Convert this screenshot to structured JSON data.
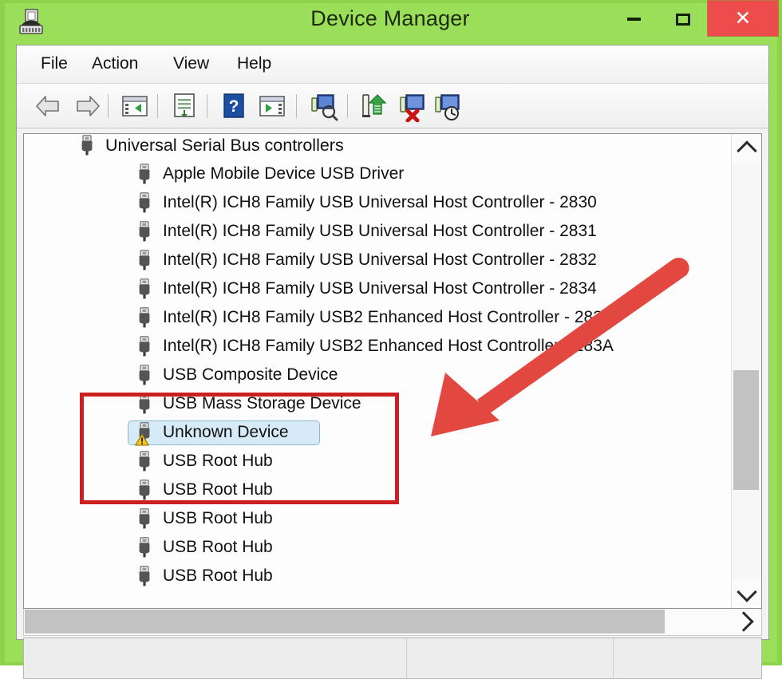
{
  "window": {
    "title": "Device Manager",
    "app_icon": "device-manager-icon",
    "frame_color": "#8ed14a",
    "controls": {
      "minimize_label": "–",
      "maximize_label": "□",
      "close_label": "✕",
      "close_bg": "#ec4c4c"
    }
  },
  "menu": {
    "items": [
      {
        "label": "File",
        "name": "menu-file"
      },
      {
        "label": "Action",
        "name": "menu-action"
      },
      {
        "label": "View",
        "name": "menu-view"
      },
      {
        "label": "Help",
        "name": "menu-help"
      }
    ]
  },
  "toolbar": {
    "buttons": [
      {
        "icon": "back-arrow-icon",
        "tooltip": "Back"
      },
      {
        "icon": "forward-arrow-icon",
        "tooltip": "Forward"
      },
      {
        "icon": "show-hide-console-tree-icon",
        "tooltip": "Show/Hide Console Tree"
      },
      {
        "icon": "properties-icon",
        "tooltip": "Properties"
      },
      {
        "icon": "help-icon",
        "tooltip": "Help"
      },
      {
        "icon": "show-hide-action-pane-icon",
        "tooltip": "Show/Hide Action Pane"
      },
      {
        "icon": "scan-for-hardware-changes-icon",
        "tooltip": "Scan for hardware changes"
      },
      {
        "icon": "update-driver-icon",
        "tooltip": "Update Driver Software"
      },
      {
        "icon": "uninstall-device-icon",
        "tooltip": "Uninstall"
      },
      {
        "icon": "disable-device-icon",
        "tooltip": "Disable"
      }
    ]
  },
  "tree": {
    "root": {
      "label": "Universal Serial Bus controllers",
      "expanded": true,
      "icon": "usb-controller-icon"
    },
    "devices": [
      {
        "label": "Apple Mobile Device USB Driver",
        "icon": "usb-device-icon",
        "selected": false,
        "warning": false
      },
      {
        "label": "Intel(R) ICH8 Family USB Universal Host Controller - 2830",
        "icon": "usb-device-icon",
        "selected": false,
        "warning": false
      },
      {
        "label": "Intel(R) ICH8 Family USB Universal Host Controller - 2831",
        "icon": "usb-device-icon",
        "selected": false,
        "warning": false
      },
      {
        "label": "Intel(R) ICH8 Family USB Universal Host Controller - 2832",
        "icon": "usb-device-icon",
        "selected": false,
        "warning": false
      },
      {
        "label": "Intel(R) ICH8 Family USB Universal Host Controller - 2834",
        "icon": "usb-device-icon",
        "selected": false,
        "warning": false
      },
      {
        "label": "Intel(R) ICH8 Family USB2 Enhanced Host Controller - 2836",
        "icon": "usb-device-icon",
        "selected": false,
        "warning": false
      },
      {
        "label": "Intel(R) ICH8 Family USB2 Enhanced Host Controller - 283A",
        "icon": "usb-device-icon",
        "selected": false,
        "warning": false
      },
      {
        "label": "USB Composite Device",
        "icon": "usb-device-icon",
        "selected": false,
        "warning": false
      },
      {
        "label": "USB Mass Storage Device",
        "icon": "usb-device-icon",
        "selected": false,
        "warning": false
      },
      {
        "label": "Unknown Device",
        "icon": "usb-device-icon",
        "selected": true,
        "warning": true
      },
      {
        "label": "USB Root Hub",
        "icon": "usb-device-icon",
        "selected": false,
        "warning": false
      },
      {
        "label": "USB Root Hub",
        "icon": "usb-device-icon",
        "selected": false,
        "warning": false
      },
      {
        "label": "USB Root Hub",
        "icon": "usb-device-icon",
        "selected": false,
        "warning": false
      },
      {
        "label": "USB Root Hub",
        "icon": "usb-device-icon",
        "selected": false,
        "warning": false
      },
      {
        "label": "USB Root Hub",
        "icon": "usb-device-icon",
        "selected": false,
        "warning": false
      }
    ],
    "selection_color": "#d6ebf7",
    "selection_border": "#8ab9d6"
  },
  "scrollbars": {
    "vertical": {
      "up_icon": "chevron-up-icon",
      "down_icon": "chevron-down-icon"
    },
    "horizontal": {
      "right_icon": "chevron-right-icon"
    }
  },
  "status_bar": {
    "panes": [
      "",
      "",
      ""
    ]
  },
  "annotations": {
    "highlight_box": {
      "name": "red-highlight-box",
      "color": "#cc1f1f"
    },
    "arrow": {
      "name": "red-pointer-arrow",
      "color": "#e2483f",
      "points_to": "Unknown Device"
    }
  }
}
